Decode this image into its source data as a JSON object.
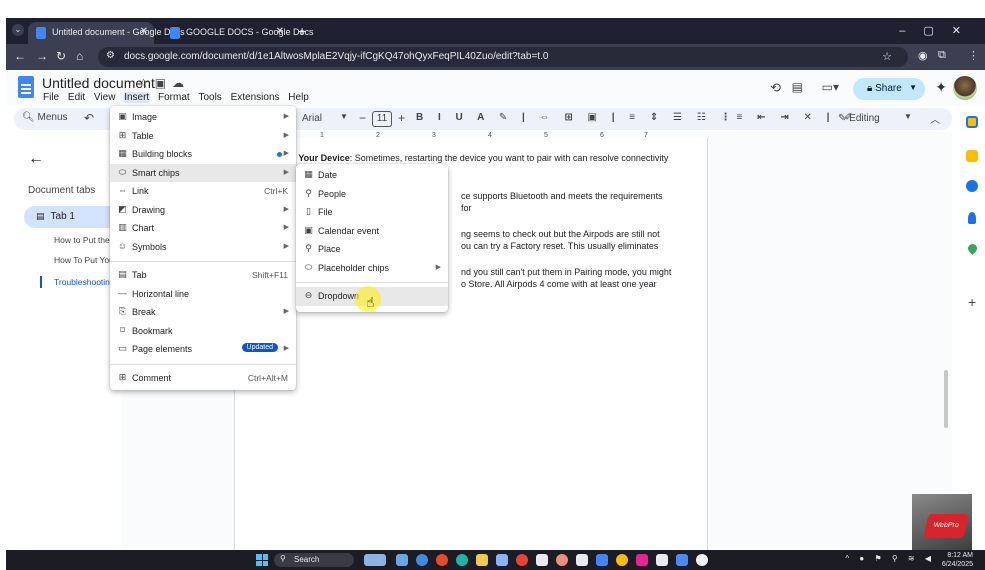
{
  "browser": {
    "tabs": [
      {
        "title": "Untitled document - Google Docs",
        "active": true
      },
      {
        "title": "GOOGLE DOCS - Google Docs",
        "active": false
      }
    ],
    "new_tab_label": "+",
    "url": "docs.google.com/document/d/1e1AltwosMplaE2Vqjy-ifCgKQ47ohQyxFeqPIL40Zuo/edit?tab=t.0"
  },
  "docs": {
    "title": "Untitled document",
    "menubar": [
      "File",
      "Edit",
      "View",
      "Insert",
      "Format",
      "Tools",
      "Extensions",
      "Help"
    ],
    "share_label": "Share",
    "menus_search": "Menus",
    "font_name": "Arial",
    "font_size": "11",
    "editing_mode": "Editing",
    "document_tabs_heading": "Document tabs",
    "tab1_label": "Tab 1",
    "outline": [
      "How to Put the",
      "How To Put You",
      "Troubleshootin"
    ]
  },
  "ruler_ticks": [
    "1",
    "2",
    "3",
    "4",
    "5",
    "6",
    "7"
  ],
  "document_text": {
    "p1_bold": "Restart Your Device",
    "p1_rest": ": Sometimes, restarting the device you want to pair with can resolve connectivity issues.",
    "p2": "ce supports Bluetooth and meets the requirements for",
    "p3a": "ng seems to check out but the Airpods are still not",
    "p3b": "ou can try a Factory reset. This usually eliminates",
    "p4a": "nd you still can't put them in Pairing mode, you might",
    "p4b": "o Store. All Airpods 4 come with at least one year"
  },
  "insert_menu": {
    "items": [
      {
        "label": "Image",
        "icon": "image-icon",
        "submenu": true
      },
      {
        "label": "Table",
        "icon": "table-icon",
        "submenu": true
      },
      {
        "label": "Building blocks",
        "icon": "building-blocks-icon",
        "submenu": true,
        "new_dot": true
      },
      {
        "label": "Smart chips",
        "icon": "smart-chips-icon",
        "submenu": true,
        "highlighted": true
      },
      {
        "label": "Link",
        "icon": "link-icon",
        "shortcut": "Ctrl+K"
      },
      {
        "label": "Drawing",
        "icon": "drawing-icon",
        "submenu": true
      },
      {
        "label": "Chart",
        "icon": "chart-icon",
        "submenu": true
      },
      {
        "label": "Symbols",
        "icon": "symbols-icon",
        "submenu": true
      },
      {
        "label": "Tab",
        "icon": "tab-icon",
        "shortcut": "Shift+F11"
      },
      {
        "label": "Horizontal line",
        "icon": "horizontal-line-icon"
      },
      {
        "label": "Break",
        "icon": "break-icon",
        "submenu": true
      },
      {
        "label": "Bookmark",
        "icon": "bookmark-icon"
      },
      {
        "label": "Page elements",
        "icon": "page-elements-icon",
        "submenu": true,
        "badge": "Updated"
      },
      {
        "label": "Comment",
        "icon": "comment-icon",
        "shortcut": "Ctrl+Alt+M"
      }
    ]
  },
  "smart_chips_menu": {
    "items": [
      {
        "label": "Date",
        "icon": "calendar-icon"
      },
      {
        "label": "People",
        "icon": "person-icon"
      },
      {
        "label": "File",
        "icon": "file-icon"
      },
      {
        "label": "Calendar event",
        "icon": "calendar-event-icon"
      },
      {
        "label": "Place",
        "icon": "place-pin-icon"
      },
      {
        "label": "Placeholder chips",
        "icon": "placeholder-chip-icon",
        "submenu": true
      },
      {
        "label": "Dropdown",
        "icon": "dropdown-icon",
        "highlighted": true
      }
    ]
  },
  "taskbar": {
    "search_label": "Search",
    "time": "8:12 AM",
    "date": "6/24/2025"
  },
  "watermark_text": "WebPro",
  "colors": {
    "accent": "#0b57d0",
    "share_bg": "#c2e7ff",
    "highlight_yellow": "#ffee00"
  }
}
